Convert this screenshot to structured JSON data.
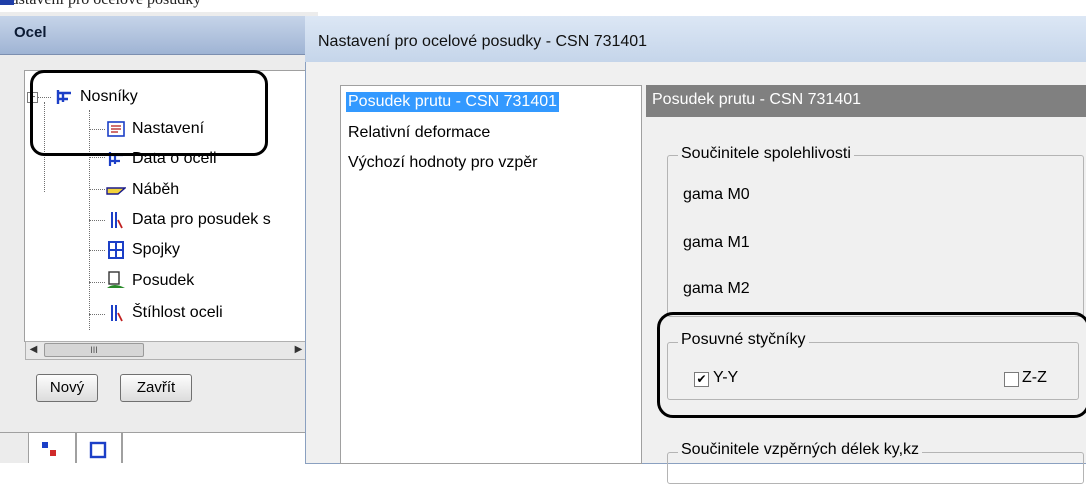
{
  "top_fragment": "Nastavení pro ocelové posudky",
  "left_panel": {
    "title": "Ocel",
    "tree": [
      {
        "label": "Nosníky",
        "icon": "beam-icon"
      },
      {
        "label": "Nastavení",
        "icon": "settings-icon"
      },
      {
        "label": "Data o oceli",
        "icon": "steel-data-icon"
      },
      {
        "label": "Náběh",
        "icon": "haunch-icon"
      },
      {
        "label": "Data pro posudek s",
        "icon": "check-data-icon"
      },
      {
        "label": "Spojky",
        "icon": "connector-icon"
      },
      {
        "label": "Posudek",
        "icon": "check-icon"
      },
      {
        "label": "Štíhlost oceli",
        "icon": "slenderness-icon"
      }
    ],
    "scroll_thumb": "III",
    "buttons": {
      "new": "Nový",
      "close": "Zavřít"
    }
  },
  "dialog": {
    "title": "Nastavení pro ocelové posudky - CSN 731401",
    "categories": [
      "Posudek prutu - CSN 731401",
      "Relativní deformace",
      "Výchozí hodnoty pro vzpěr"
    ],
    "panel_header": "Posudek prutu - CSN 731401",
    "group_reliability": {
      "legend": "Součinitele spolehlivosti",
      "fields": [
        "gama M0",
        "gama M1",
        "gama M2"
      ]
    },
    "group_sway": {
      "legend": "Posuvné styčníky",
      "yy_label": "Y-Y",
      "yy_checked": true,
      "zz_label": "Z-Z",
      "zz_checked": false
    },
    "group_buckling": {
      "legend": "Součinitele vzpěrných délek ky,kz"
    }
  }
}
